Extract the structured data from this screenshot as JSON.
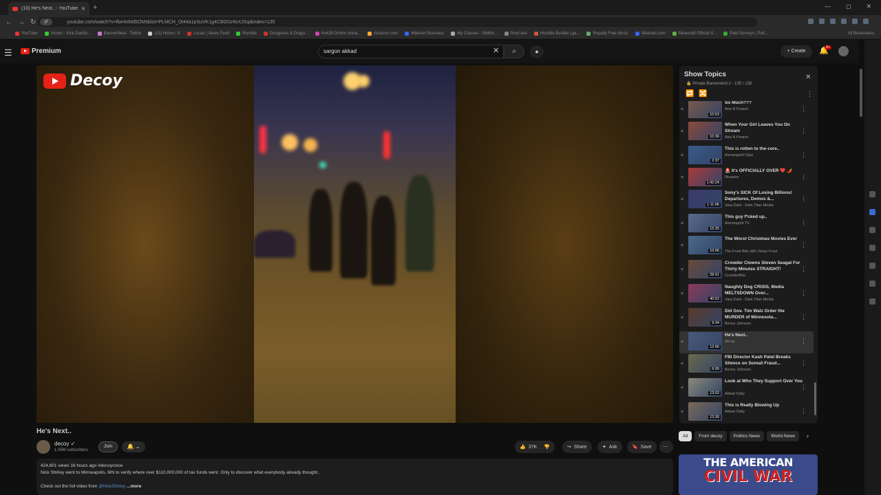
{
  "browser": {
    "tab_title": "(10) He's Next.. - YouTube",
    "new_tab": "+",
    "url": "youtube.com/watch?v=fbe4nMd5OMI&list=PLMCH_Ol44a1pSuVK1g4CBOI1rttsXJSq&index=135",
    "url_chip": "yt",
    "window_controls": [
      "—",
      "◻",
      "✕"
    ],
    "bookmarks": [
      "YouTube",
      "Vroom - Kick Dashb...",
      "BannerMeal - Twitch",
      "(13) Home / X",
      "Locals | News Feed",
      "Rumble",
      "Dungeons & Drago...",
      "ho428 Online virtua...",
      "Amazon.com",
      "Walmart Business",
      "My Classes - Skillsh...",
      "Root.dev",
      "Humble Bundle | ga...",
      "Royalty Free Music",
      "Walmart.com",
      "Minecraft Official S...",
      "Paid Surveys | Pull..."
    ],
    "all_bookmarks": "All Bookmarks"
  },
  "header": {
    "logo": "Premium",
    "search_value": "sargon akkad",
    "create_label": "Create",
    "notif_count": "9+"
  },
  "player": {
    "channel_watermark": "Decoy"
  },
  "video": {
    "title": "He's Next..",
    "channel": "decoy",
    "subscribers": "1.05M subscribers",
    "join": "Join",
    "likes": "37K",
    "share": "Share",
    "ask": "Ask",
    "save": "Save",
    "meta": "424,601 views  16 hours ago  #decoyvoice",
    "description": "Nick Shirley went to Minneapolis, MN to verify where over $110,000,000 of tax funds went. Only to discover what everybody already thought..",
    "link_prefix": "Check out the full video from ",
    "mention": "@NickShirley",
    "more": "...more"
  },
  "playlist": {
    "title": "Show Topics",
    "subtitle": "Private  Barrenwind 2 - 135 / 138",
    "items": [
      {
        "title": "So Much???",
        "channel": "Aba N Preach",
        "duration": "10:53"
      },
      {
        "title": "When Your Girl Leaves You On Stream",
        "channel": "Aba N Preach",
        "duration": "10:36"
      },
      {
        "title": "This is rotten to the core..",
        "channel": "Asmongold Clips",
        "duration": "2:37"
      },
      {
        "title": "🚨 It's OFFICIALLY OVER ❤️ 🌶️",
        "channel": "Nuxanor",
        "duration": "1:42:24"
      },
      {
        "title": "Sony's SICK Of Losing Billions! Departures, Demos &...",
        "channel": "Vara Dark - Dark Titan Media",
        "duration": "1:11:06"
      },
      {
        "title": "This guy f*cked up..",
        "channel": "Asmongold TV",
        "duration": "15:25"
      },
      {
        "title": "The Worst Christmas Movies Ever",
        "channel": "The Frost Bite with Vivian Frost",
        "duration": "10:06"
      },
      {
        "title": "Crowder Clowns Steven Seagal For Thirty Minutes STRAIGHT!",
        "channel": "CrowderBits",
        "duration": "28:01"
      },
      {
        "title": "Naughty Dog CRISIS, Media MELTSDOWN Over...",
        "channel": "Vara Dark - Dark Titan Media",
        "duration": "40:52"
      },
      {
        "title": "Did Gov. Tim Walz Order the MURDER of Minnesota...",
        "channel": "Benny Johnson",
        "duration": "9:34"
      },
      {
        "title": "He's Next..",
        "channel": "decoy",
        "duration": "12:06"
      },
      {
        "title": "FBI Director Kash Patel Breaks Silence on Somali Fraud...",
        "channel": "Benny Johnson",
        "duration": "6:09"
      },
      {
        "title": "Look at Who They Support Over You",
        "channel": "Akkad Daily",
        "duration": "13:02"
      },
      {
        "title": "This is Really Blowing Up",
        "channel": "Akkad Daily",
        "duration": "13:30"
      }
    ]
  },
  "chips": [
    "All",
    "From decoy",
    "Politics News",
    "World News"
  ],
  "ad": {
    "line1": "THE AMERICAN",
    "line2": "CIVIL WAR"
  },
  "colors": {
    "brand_red": "#e62117",
    "background": "#0f0f0f"
  }
}
